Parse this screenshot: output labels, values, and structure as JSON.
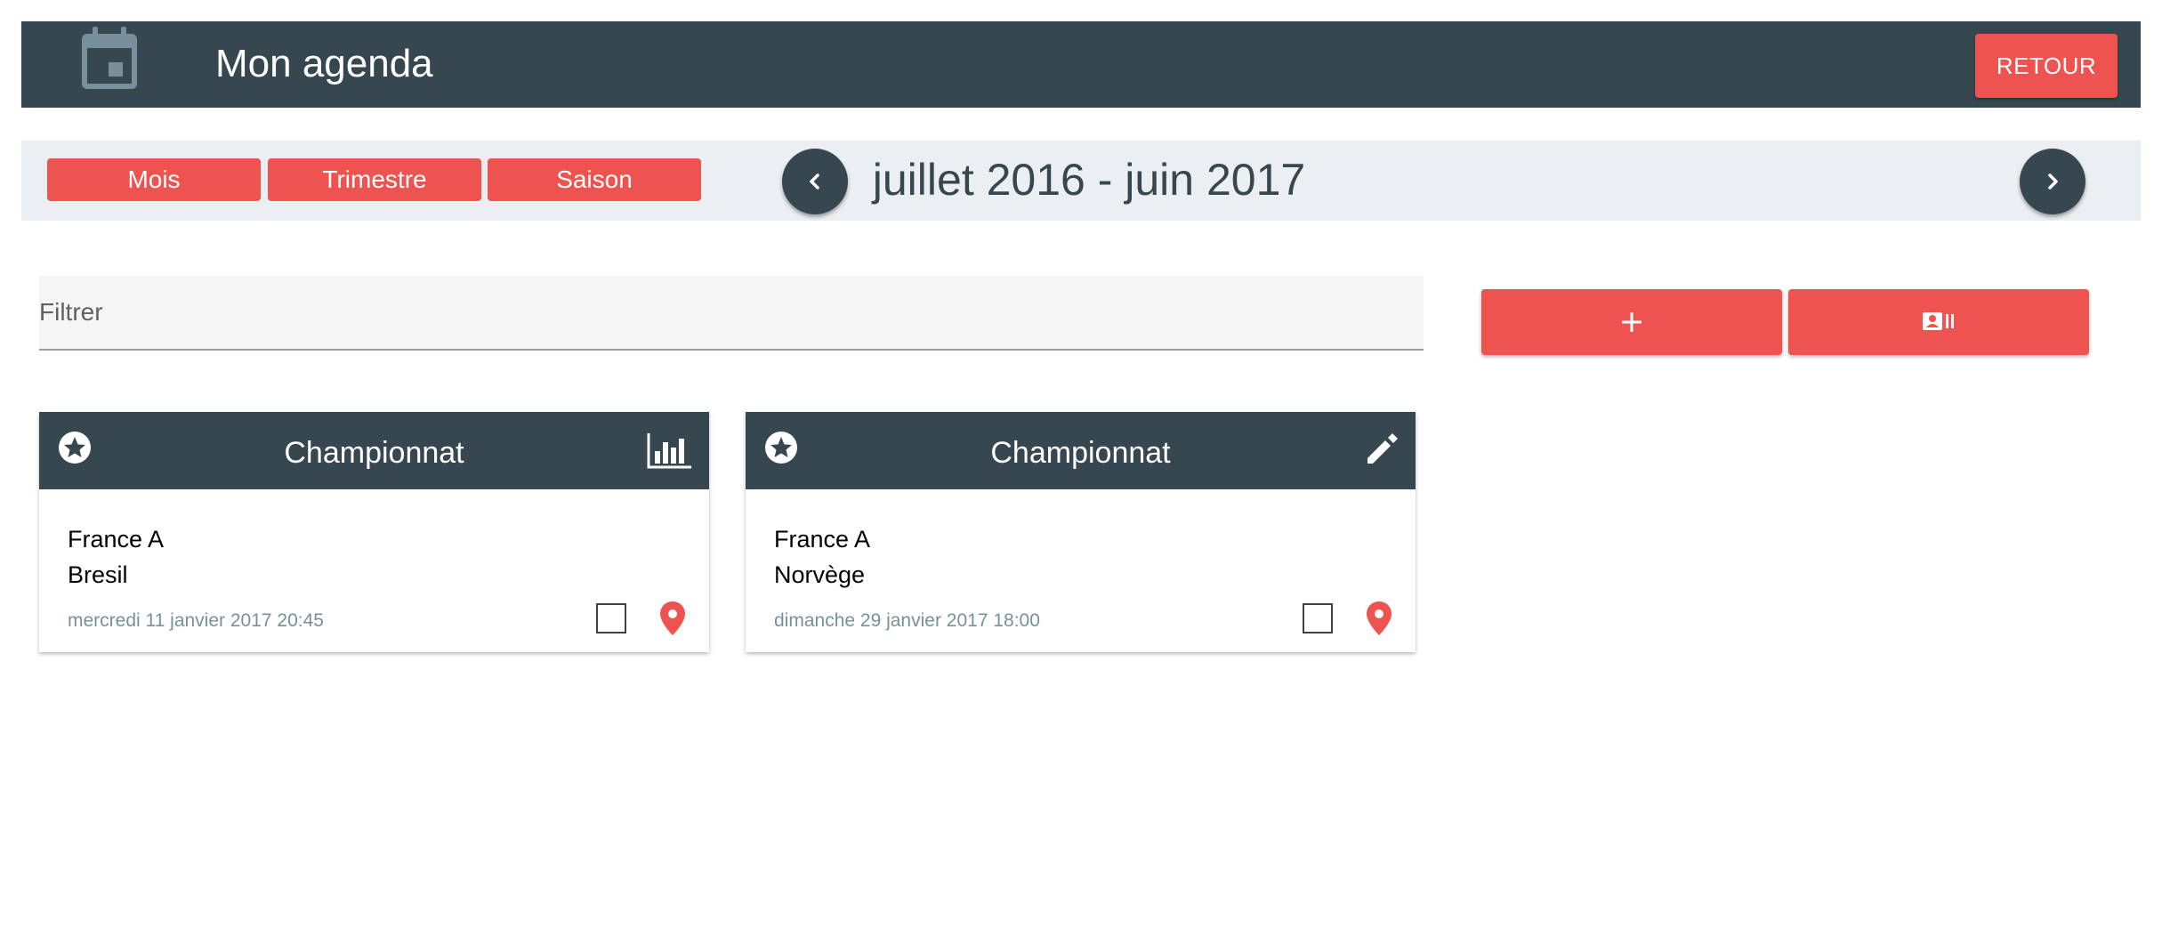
{
  "header": {
    "title": "Mon agenda",
    "back_label": "RETOUR",
    "icon": "calendar-icon"
  },
  "period": {
    "buttons": [
      "Mois",
      "Trimestre",
      "Saison"
    ],
    "label": "juillet 2016 - juin 2017",
    "prev_icon": "chevron-left-icon",
    "next_icon": "chevron-right-icon"
  },
  "filter": {
    "placeholder": "Filtrer",
    "value": ""
  },
  "actions": {
    "add_icon": "plus-icon",
    "contact_icon": "contact-card-icon"
  },
  "events": [
    {
      "title": "Championnat",
      "home": "France A",
      "away": "Bresil",
      "date": "mercredi 11 janvier 2017 20:45",
      "header_right_icon": "bar-chart-icon",
      "checked": false
    },
    {
      "title": "Championnat",
      "home": "France A",
      "away": "Norvège",
      "date": "dimanche 29 janvier 2017 18:00",
      "header_right_icon": "pencil-icon",
      "checked": false
    }
  ],
  "colors": {
    "primary_dark": "#37474f",
    "accent": "#ef5350",
    "bar_light": "#eceff1",
    "muted_text": "#78909c"
  }
}
